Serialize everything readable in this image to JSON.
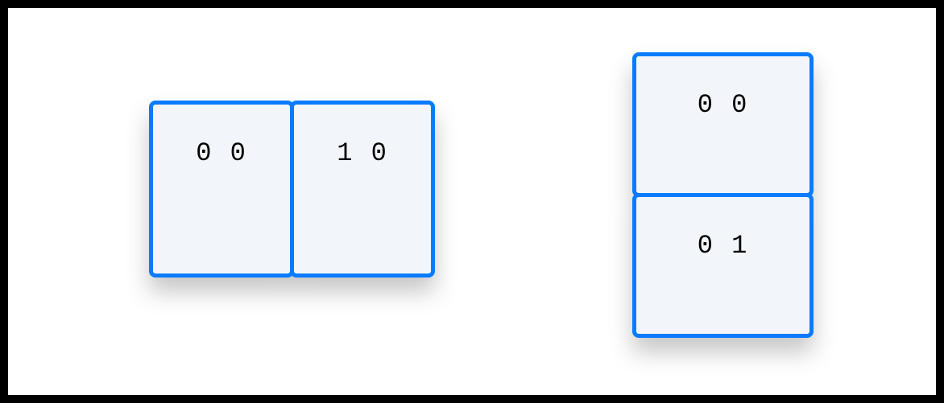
{
  "diagram": {
    "left_group": {
      "orientation": "horizontal",
      "cells": [
        {
          "label": "0 0"
        },
        {
          "label": "1 0"
        }
      ]
    },
    "right_group": {
      "orientation": "vertical",
      "cells": [
        {
          "label": "0 0"
        },
        {
          "label": "0 1"
        }
      ]
    },
    "style": {
      "border_color": "#0a7bff",
      "cell_bg": "#f2f6fa"
    }
  }
}
